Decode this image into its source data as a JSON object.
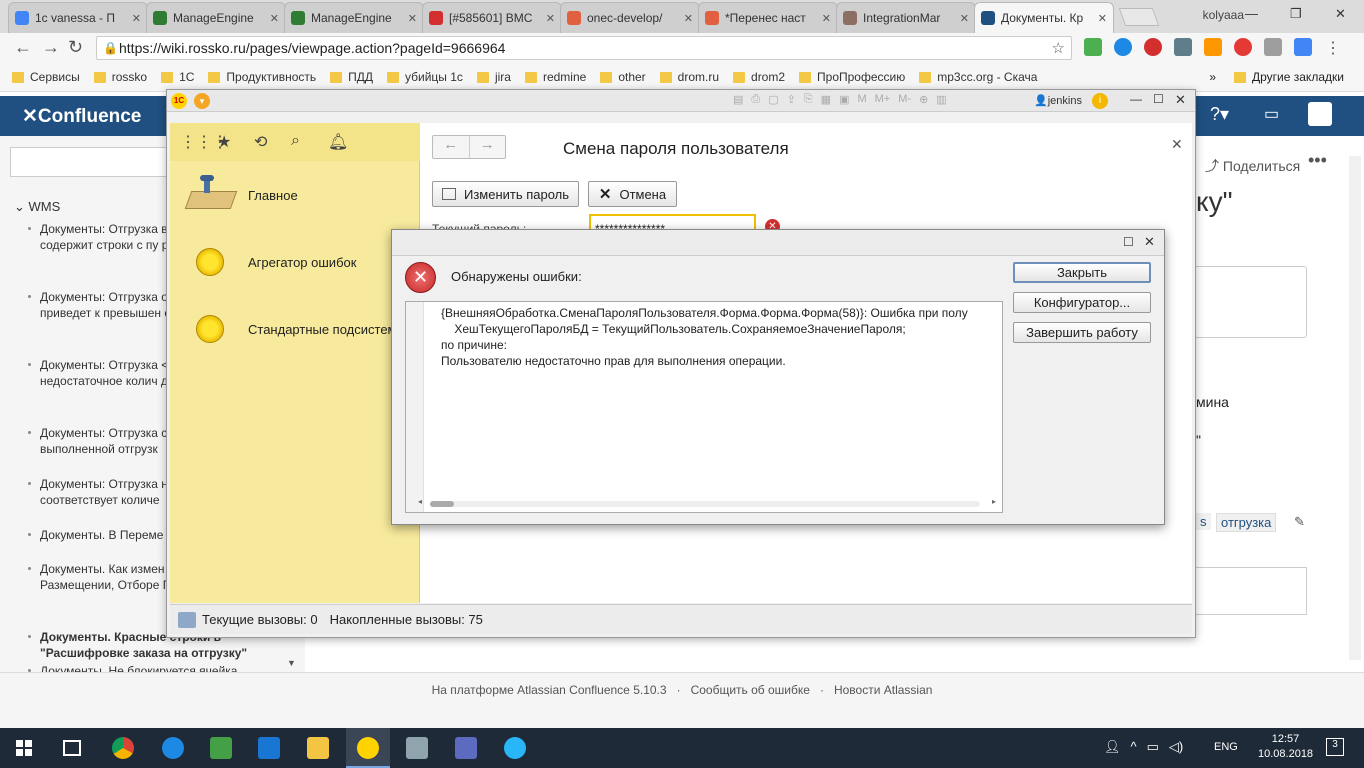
{
  "browser": {
    "tabs": [
      {
        "label": "1c vanessa - П",
        "color": "#4285f4"
      },
      {
        "label": "ManageEngine",
        "color": "#2e7d32"
      },
      {
        "label": "ManageEngine",
        "color": "#2e7d32"
      },
      {
        "label": "[#585601] BMC",
        "color": "#d32f2f"
      },
      {
        "label": "onec-develop/",
        "color": "#e06040"
      },
      {
        "label": "*Перенес наст",
        "color": "#e06040"
      },
      {
        "label": "IntegrationMar",
        "color": "#8d6e63"
      },
      {
        "label": "Документы. Кр",
        "color": "#205081"
      }
    ],
    "profile": "kolyaaa",
    "url": "https://wiki.rossko.ru/pages/viewpage.action?pageId=9666964",
    "bookmarks": [
      "Сервисы",
      "rossko",
      "1С",
      "Продуктивность",
      "ПДД",
      "убийцы 1с",
      "jira",
      "redmine",
      "other",
      "drom.ru",
      "drom2",
      "ПроПрофессию",
      "mp3cc.org - Скача"
    ],
    "other_bookmarks": "Другие закладки"
  },
  "confluence": {
    "logo": "Confluence",
    "space_label": "WMS",
    "share": "Поделиться",
    "title_fragment": "ку\"",
    "right_fragments": [
      "мина",
      "\"",
      "s",
      "отгрузка"
    ],
    "sidebar_items": [
      "Документы: Отгрузка выполнены, документ содержит строки с пу размещением в коло",
      "Документы: Отгрузка операции по номенкл приведет к превышен отгрузку.",
      "Документы: Отгрузка <ячейка с типом \"отгр недостаточное колич для выполнения опер",
      "Документы: Отгрузка строки в \"Контроль от выполненной отгрузк",
      "Документы: Отгрузка номенклатуре: ........ соответствует количе",
      "Документы. В Переме создалась строка \"По",
      "Документы. Как измен исполнителя в Прием Размещении, Отборе Перемещении",
      "Документы. Красные строки в \"Расшифровке заказа на отгрузку\"",
      "Документы. Не блокируется ячейка"
    ],
    "footer": [
      "На платформе Atlassian Confluence 5.10.3",
      "Сообщить об ошибке",
      "Новости Atlassian"
    ]
  },
  "onec": {
    "user": "jenkins",
    "nav_items": [
      "Главное",
      "Агрегатор ошибок",
      "Стандартные подсистем"
    ],
    "form_title": "Смена пароля пользователя",
    "change_password_button": "Изменить пароль",
    "cancel_button": "Отмена",
    "current_password_label": "Текущий пароль:",
    "current_password_value": "***************",
    "status_current": "Текущие вызовы: 0",
    "status_accumulated": "Накопленные вызовы: 75"
  },
  "error_dialog": {
    "title": "Обнаружены ошибки:",
    "lines": [
      "{ВнешняяОбработка.СменаПароляПользователя.Форма.Форма.Форма(58)}: Ошибка при полу",
      "    ХешТекущегоПароляБД = ТекущийПользователь.СохраняемоеЗначениеПароля;",
      "по причине:",
      "Пользователю недостаточно прав для выполнения операции."
    ],
    "close_button": "Закрыть",
    "configurator_button": "Конфигуратор...",
    "exit_button": "Завершить работу"
  },
  "taskbar": {
    "lang": "ENG",
    "time": "12:57",
    "date": "10.08.2018",
    "notifications": "3"
  }
}
